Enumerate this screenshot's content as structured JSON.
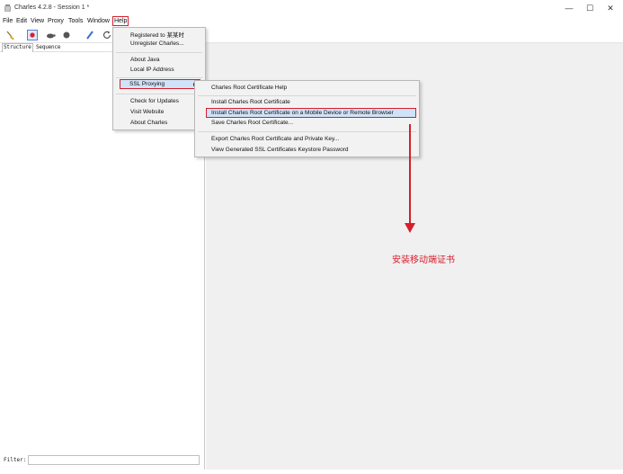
{
  "window": {
    "title": "Charles 4.2.8 - Session 1 *",
    "minimize": "—",
    "maximize": "☐",
    "close": "✕"
  },
  "menubar": {
    "items": [
      "File",
      "Edit",
      "View",
      "Proxy",
      "Tools",
      "Window",
      "Help"
    ],
    "active": "Help"
  },
  "left_pane": {
    "tabs": [
      "Structure",
      "Sequence"
    ],
    "filter_label": "Filter:"
  },
  "help_menu": {
    "items": [
      "Registered to 某某时",
      "Unregister Charles...",
      "About Java",
      "Local IP Address",
      "SSL Proxying",
      "Check for Updates",
      "Visit Website",
      "About Charles"
    ]
  },
  "ssl_submenu": {
    "items": [
      "Charles Root Certificate Help",
      "Install Charles Root Certificate",
      "Install Charles Root Certificate on a Mobile Device or Remote Browser",
      "Save Charles Root Certificate...",
      "Export Charles Root Certificate and Private Key...",
      "View Generated SSL Certificates Keystore Password"
    ]
  },
  "annotation": {
    "text": "安装移动端证书"
  },
  "colors": {
    "highlight_border": "#d81e2c",
    "menu_highlight": "#cfe3f8",
    "menu_bg": "#f2f2f2",
    "pane_bg": "#f0f0f0"
  },
  "icons": {
    "app": "charles-jug-icon",
    "toolbar": [
      "broom-icon",
      "record-icon",
      "turtle-icon",
      "breakpoint-icon",
      "pen-icon",
      "refresh-icon"
    ]
  }
}
